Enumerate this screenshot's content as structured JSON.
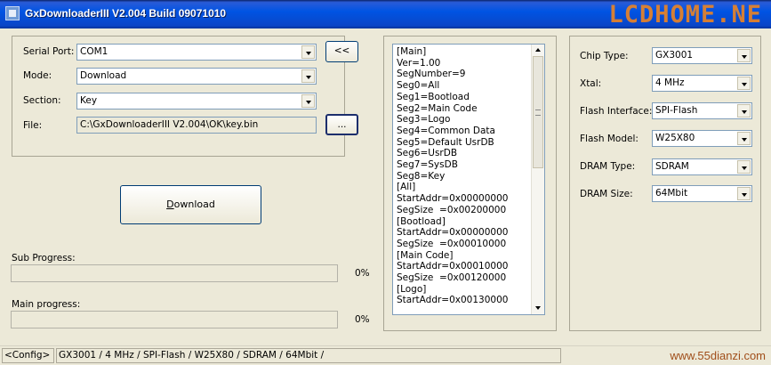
{
  "window": {
    "title": "GxDownloaderIII V2.004 Build 09071010",
    "logo_text": "LCDHOME.NE"
  },
  "settings": {
    "serial_port_label": "Serial Port:",
    "serial_port_value": "COM1",
    "refresh_button": "<<",
    "mode_label": "Mode:",
    "mode_value": "Download",
    "section_label": "Section:",
    "section_value": "Key",
    "file_label": "File:",
    "file_value": "C:\\GxDownloaderIII V2.004\\OK\\key.bin",
    "browse_button": "..."
  },
  "actions": {
    "download_button": "Download"
  },
  "progress": {
    "sub_label": "Sub Progress:",
    "sub_percent": "0%",
    "sub_value": 0,
    "main_label": "Main progress:",
    "main_percent": "0%",
    "main_value": 0
  },
  "config_list": {
    "lines": [
      "[Main]",
      "Ver=1.00",
      "SegNumber=9",
      "Seg0=All",
      "Seg1=Bootload",
      "Seg2=Main Code",
      "Seg3=Logo",
      "Seg4=Common Data",
      "Seg5=Default UsrDB",
      "Seg6=UsrDB",
      "Seg7=SysDB",
      "Seg8=Key",
      "[All]",
      "StartAddr=0x00000000",
      "SegSize  =0x00200000",
      "[Bootload]",
      "StartAddr=0x00000000",
      "SegSize  =0x00010000",
      "[Main Code]",
      "StartAddr=0x00010000",
      "SegSize  =0x00120000",
      "[Logo]",
      "StartAddr=0x00130000"
    ]
  },
  "chip": {
    "chip_type_label": "Chip Type:",
    "chip_type_value": "GX3001",
    "xtal_label": "Xtal:",
    "xtal_value": "4 MHz",
    "flash_interface_label": "Flash Interface:",
    "flash_interface_value": "SPI-Flash",
    "flash_model_label": "Flash Model:",
    "flash_model_value": "W25X80",
    "dram_type_label": "DRAM Type:",
    "dram_type_value": "SDRAM",
    "dram_size_label": "DRAM Size:",
    "dram_size_value": "64Mbit"
  },
  "statusbar": {
    "config_button": "<Config>",
    "summary": "GX3001 / 4 MHz / SPI-Flash / W25X80 / SDRAM / 64Mbit /",
    "watermark": "www.55dianzi.com"
  }
}
